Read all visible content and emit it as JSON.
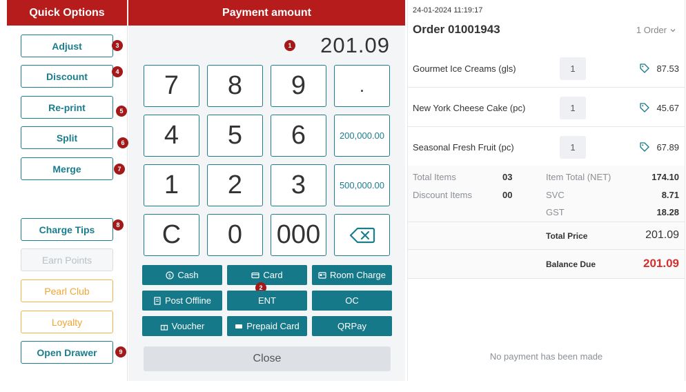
{
  "left_panel": {
    "title": "Quick Options",
    "buttons": [
      "Adjust",
      "Discount",
      "Re-print",
      "Split",
      "Merge",
      "Charge Tips",
      "Earn Points",
      "Pearl Club",
      "Loyalty",
      "Open Drawer"
    ],
    "badges": [
      "3",
      "4",
      "5",
      "6",
      "7",
      "8",
      "9"
    ]
  },
  "payment": {
    "title": "Payment amount",
    "amount": "201.09",
    "badge_1": "1",
    "badge_2": "2",
    "keys": [
      "7",
      "8",
      "9",
      ".",
      "4",
      "5",
      "6",
      "200,000.00",
      "1",
      "2",
      "3",
      "500,000.00",
      "C",
      "0",
      "000"
    ],
    "backspace_icon": "backspace-icon",
    "methods": [
      "Cash",
      "Card",
      "Room Charge",
      "Post Offline",
      "ENT",
      "OC",
      "Voucher",
      "Prepaid Card",
      "QRPay"
    ],
    "close": "Close"
  },
  "order": {
    "timestamp": "24-01-2024 11:19:17",
    "title": "Order 01001943",
    "count": "1 Order",
    "items": [
      {
        "name": "Gourmet Ice Creams (gls)",
        "qty": "1",
        "price": "87.53"
      },
      {
        "name": "New York Cheese Cake (pc)",
        "qty": "1",
        "price": "45.67"
      },
      {
        "name": "Seasonal Fresh Fruit (pc)",
        "qty": "1",
        "price": "67.89"
      }
    ],
    "summary": {
      "total_items_label": "Total Items",
      "total_items": "03",
      "discount_items_label": "Discount Items",
      "discount_items": "00",
      "item_total_label": "Item Total (NET)",
      "item_total": "174.10",
      "svc_label": "SVC",
      "svc": "8.71",
      "gst_label": "GST",
      "gst": "18.28"
    },
    "total_price_label": "Total Price",
    "total_price": "201.09",
    "balance_due_label": "Balance Due",
    "balance_due": "201.09",
    "no_payment": "No payment has been made"
  },
  "colors": {
    "brand_red": "#b71c1c",
    "teal": "#15798a",
    "orange": "#f2a531",
    "balance_red": "#d32f2f"
  }
}
